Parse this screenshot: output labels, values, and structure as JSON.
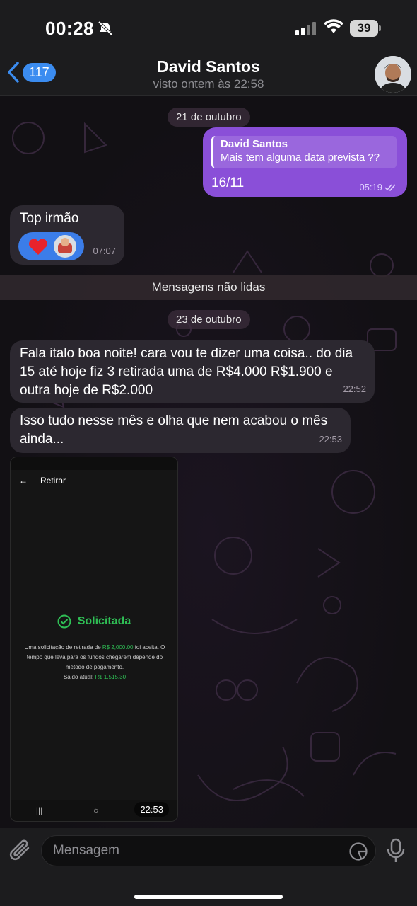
{
  "status_bar": {
    "time": "00:28",
    "battery": "39"
  },
  "header": {
    "back_count": "117",
    "contact_name": "David Santos",
    "last_seen": "visto ontem às 22:58"
  },
  "date_labels": {
    "first": "21 de outubro",
    "second": "23 de outubro"
  },
  "unread_label": "Mensagens não lidas",
  "messages": {
    "outgoing_1": {
      "reply_name": "David Santos",
      "reply_text": "Mais tem alguma data prevista ??",
      "text": "16/11",
      "time": "05:19"
    },
    "incoming_1": {
      "text": "Top irmão",
      "time": "07:07"
    },
    "incoming_2": {
      "text": "Fala italo boa noite! cara vou te dizer uma coisa.. do dia 15 até hoje fiz 3 retirada uma de R$4.000 R$1.900 e outra hoje de R$2.000",
      "time": "22:52"
    },
    "incoming_3": {
      "text": "Isso tudo nesse mês e olha que nem acabou o mês ainda...",
      "time": "22:53"
    },
    "image": {
      "app_title": "Retirar",
      "status": "Solicitada",
      "desc_1": "Uma solicitação de retirada de ",
      "amount": "R$ 2,000.00",
      "desc_2": " foi aceita. O tempo que leva para os fundos chegarem depende do método de pagamento.",
      "balance_label": "Saldo atual: ",
      "balance_value": "R$ 1,515.30",
      "time": "22:53"
    }
  },
  "input": {
    "placeholder": "Mensagem"
  },
  "colors": {
    "outgoing_bubble": "#8a4fd8",
    "incoming_bubble": "#2c2830",
    "accent": "#3b8cf0",
    "success": "#2fbf55"
  }
}
